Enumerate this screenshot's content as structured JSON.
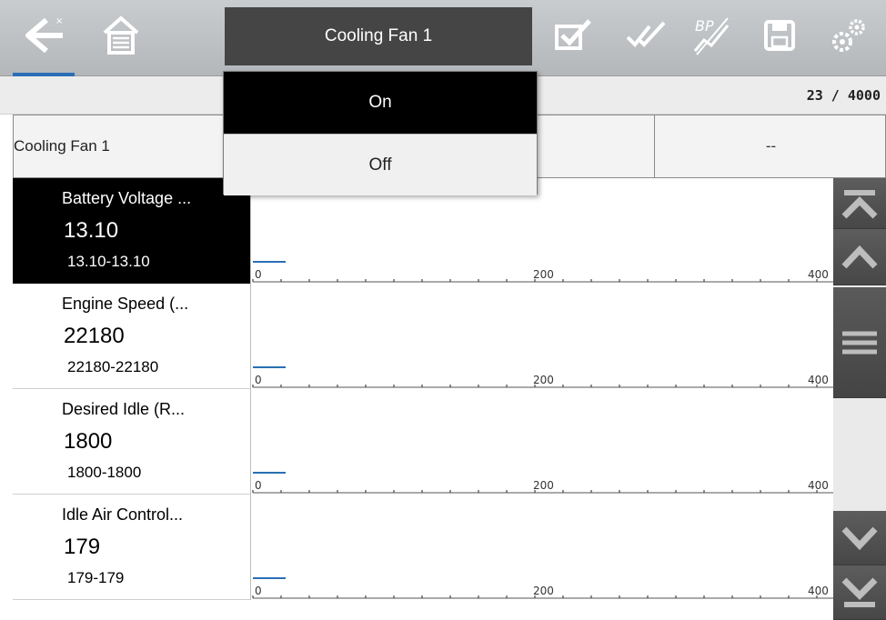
{
  "toolbar": {
    "title": "Cooling Fan 1",
    "icons": [
      "back-icon",
      "home-icon",
      "check-icon",
      "double-check-icon",
      "graph-edit-icon",
      "save-icon",
      "settings-icon"
    ]
  },
  "status": {
    "counter": "23 / 4000"
  },
  "pid_row": {
    "name": "Cooling Fan 1",
    "value": "--"
  },
  "dropdown": {
    "options": [
      "On",
      "Off"
    ],
    "selected": "On"
  },
  "rows": [
    {
      "name": "Battery Voltage ...",
      "value": "13.10",
      "range": "13.10-13.10",
      "selected": true
    },
    {
      "name": "Engine Speed (...",
      "value": "22180",
      "range": "22180-22180",
      "selected": false
    },
    {
      "name": "Desired Idle (R...",
      "value": "1800",
      "range": "1800-1800",
      "selected": false
    },
    {
      "name": "Idle Air Control...",
      "value": "179",
      "range": "179-179",
      "selected": false
    }
  ],
  "graph_axis": {
    "ticks": [
      "0",
      "200",
      "400"
    ]
  },
  "colors": {
    "accent": "#2a6fb6",
    "toolbar": "#bfc2c5",
    "selected": "#000000"
  }
}
